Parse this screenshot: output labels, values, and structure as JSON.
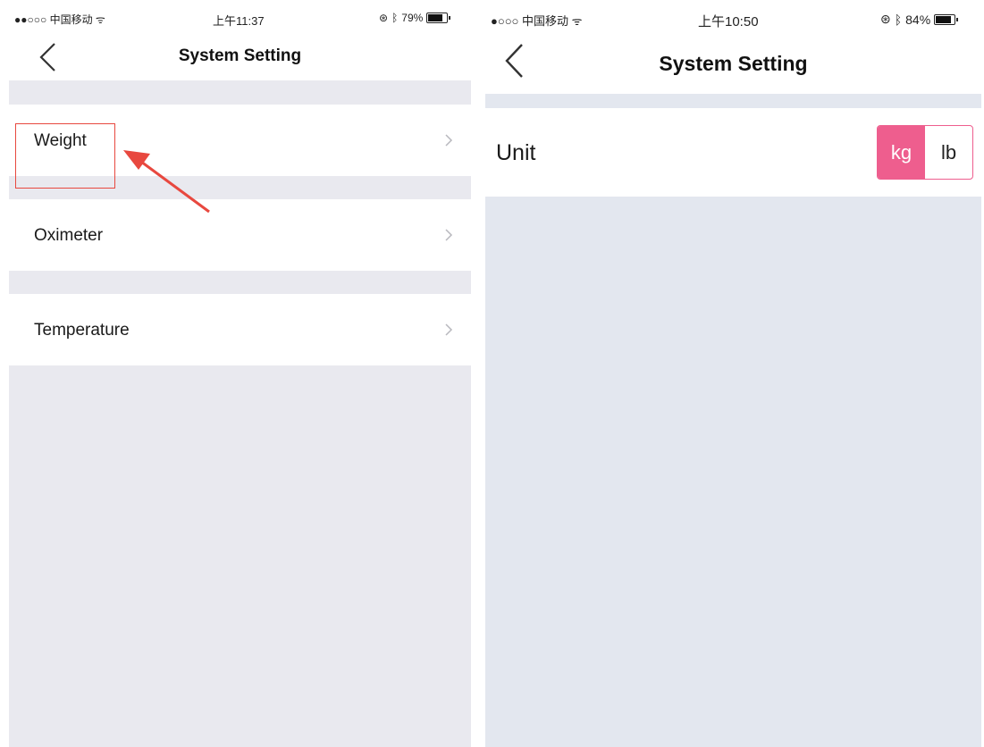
{
  "left_screen": {
    "status": {
      "carrier": "●●○○○ 中国移动 ᯤ",
      "time": "上午11:37",
      "battery_text": "79%",
      "battery_level": 0.79
    },
    "title": "System Setting",
    "items": [
      {
        "label": "Weight"
      },
      {
        "label": "Oximeter"
      },
      {
        "label": "Temperature"
      }
    ]
  },
  "right_screen": {
    "status": {
      "carrier": "●○○○ 中国移动 ᯤ",
      "time": "上午10:50",
      "battery_text": "84%",
      "battery_level": 0.84
    },
    "title": "System Setting",
    "unit": {
      "label": "Unit",
      "options": [
        "kg",
        "lb"
      ],
      "selected": "kg"
    }
  },
  "colors": {
    "accent": "#ee5e8e",
    "annotation": "#e8483f"
  },
  "icons": {
    "back": "chevron-left-icon",
    "disclosure": "chevron-right-icon",
    "bluetooth": "bluetooth-icon",
    "alarm": "alarm-icon",
    "wifi": "wifi-icon"
  }
}
